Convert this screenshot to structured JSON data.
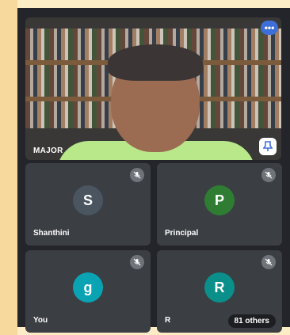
{
  "featured": {
    "name": "MAJOR",
    "more_label": "•••",
    "more_icon": "more-options-icon",
    "pin_icon": "pin-icon"
  },
  "participants": [
    {
      "initial": "S",
      "name": "Shanthini",
      "avatar_color": "#4a5560"
    },
    {
      "initial": "P",
      "name": "Principal",
      "avatar_color": "#2e7d32"
    },
    {
      "initial": "g",
      "name": "You",
      "avatar_color": "#0aa3b4"
    },
    {
      "initial": "R",
      "name": "R",
      "avatar_color": "#0a8f8a"
    }
  ],
  "others_label": "81 others",
  "colors": {
    "background": "#fdedc6",
    "stage": "#23252a",
    "tile": "#3b3e43",
    "accent": "#3e6fd8"
  }
}
